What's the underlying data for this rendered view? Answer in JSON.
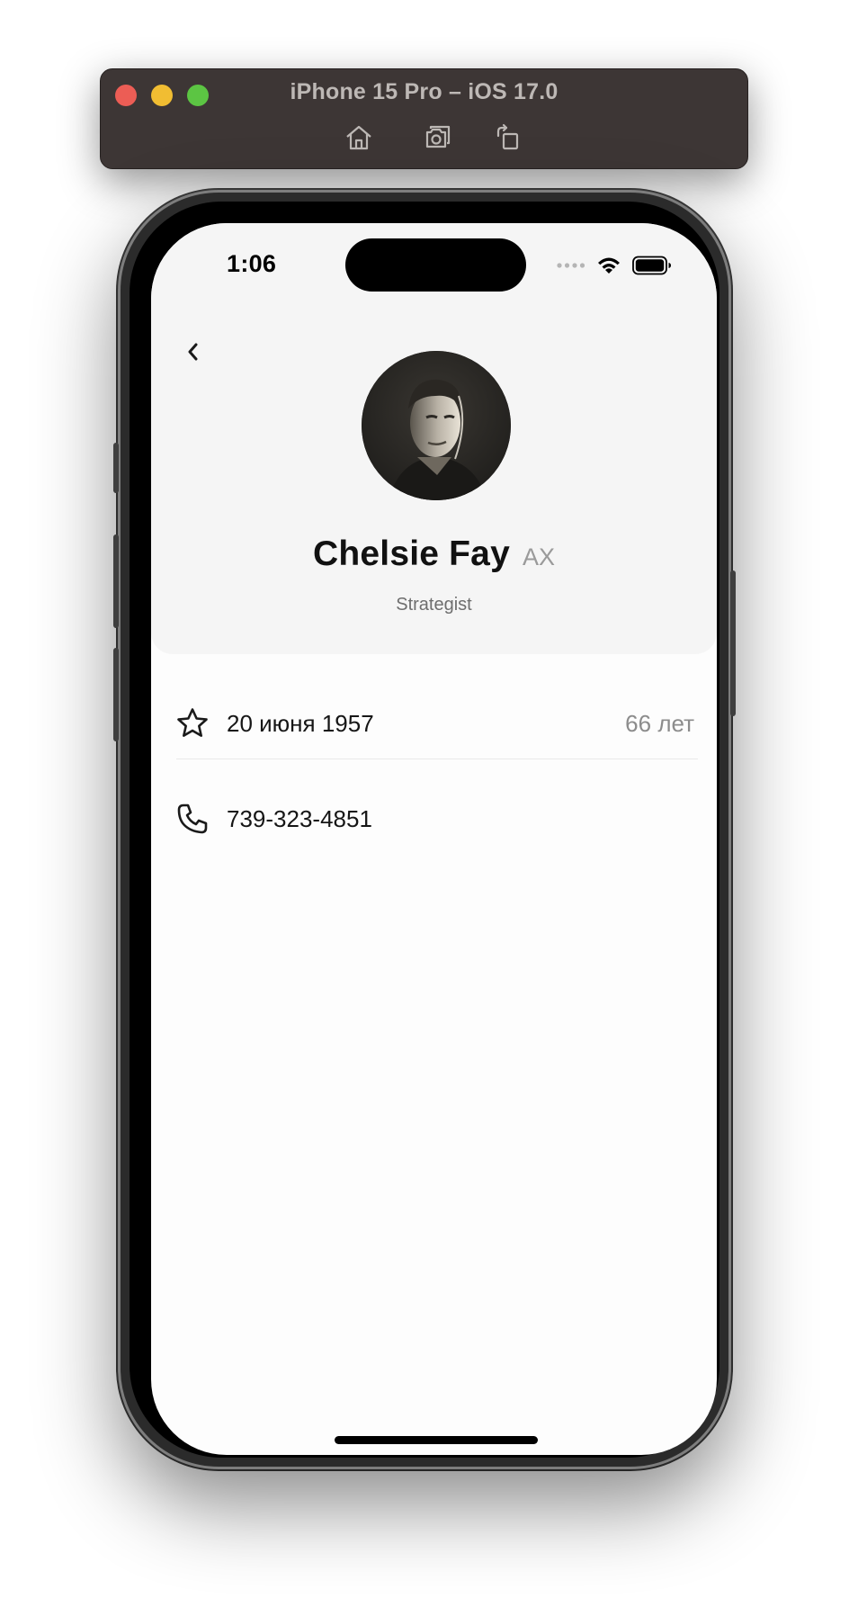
{
  "simulator": {
    "title": "iPhone 15 Pro – iOS 17.0",
    "buttons": [
      "home-icon",
      "screenshot-icon",
      "rotate-icon"
    ]
  },
  "status_bar": {
    "time": "1:06",
    "icons": [
      "cellular-signal-icon",
      "wifi-icon",
      "battery-icon"
    ]
  },
  "profile": {
    "name": "Chelsie Fay",
    "code": "AX",
    "role": "Strategist",
    "avatar_icon": "portrait-photo"
  },
  "info": {
    "birthday": {
      "icon": "star-icon",
      "date": "20 июня 1957",
      "age": "66 лет"
    },
    "phone": {
      "icon": "phone-icon",
      "number": "739-323-4851"
    }
  },
  "colors": {
    "header_background": "#f5f5f5",
    "screen_background": "#fdfdfd",
    "toolbar_background": "#3d3635",
    "secondary_text": "#8c8c8c"
  }
}
